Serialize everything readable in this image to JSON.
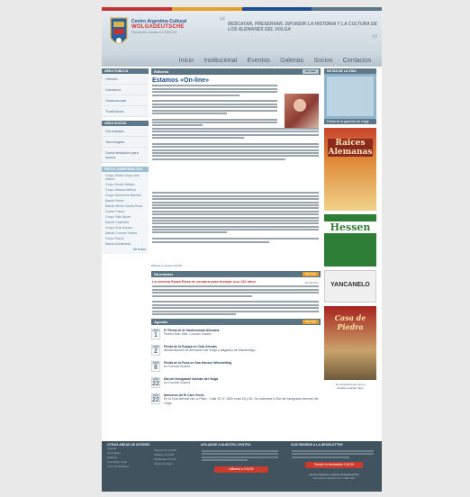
{
  "header": {
    "org_line1": "Centro Argentino Cultural",
    "org_line2": "WOLGADEUTSCHE",
    "org_line3": "Personería Jurídica IGJ 000 000",
    "quote": "RESCATAR, PRESERVAR, DIFUNDIR LA HISTORIA Y LA CULTURA DE LOS ALEMANES DEL VOLGA",
    "colors": {
      "accent": "#c33333",
      "brand": "#1d4f91",
      "sidebar": "#5e7889",
      "footer": "#41535f",
      "orange": "#e3a02b"
    }
  },
  "nav": {
    "items": [
      {
        "label": "Inicio"
      },
      {
        "label": "Institucional"
      },
      {
        "label": "Eventos"
      },
      {
        "label": "Galerias"
      },
      {
        "label": "Socios"
      },
      {
        "label": "Contactos"
      }
    ]
  },
  "left": {
    "box1": {
      "title": "AREA PUBLICA",
      "items": [
        {
          "label": "Historia"
        },
        {
          "label": "Literatura"
        },
        {
          "label": "Gastronomia"
        },
        {
          "label": "Tradiciones"
        }
      ]
    },
    "box2": {
      "title": "AREA SOCIOS",
      "items": [
        {
          "label": "Genealogía"
        },
        {
          "label": "Tecnologías"
        },
        {
          "label": "Documentación para socios"
        }
      ]
    },
    "fiesta": {
      "title": "FIESTA CAMPESINA 2011",
      "items": [
        {
          "label": "Grupo Sinsal Grupo Aus Ultdorf"
        },
        {
          "label": "Grupo Sinsal Villalba"
        },
        {
          "label": "Grupo Strauss Merino"
        },
        {
          "label": "Grupo Sarmiento Bismark"
        },
        {
          "label": "Banda Pardo"
        },
        {
          "label": "Banda Merino Santa Rosa"
        },
        {
          "label": "Cortez Pasca"
        },
        {
          "label": "Grupo Villa Sauze"
        },
        {
          "label": "Banda Calandria"
        },
        {
          "label": "Grupo Gran Aurora"
        },
        {
          "label": "Banda Coronel Suarez"
        },
        {
          "label": "Grupo Saenz"
        },
        {
          "label": "Banda Avellaneda"
        }
      ],
      "more": "Ver todos"
    }
  },
  "main": {
    "editorial": {
      "title": "Editorial",
      "button": "Ver mas",
      "headline": "Estamos «On-line»",
      "link": "Alleinas a nuestra CACW"
    },
    "novedades": {
      "title": "Novedades",
      "button": "Ver mas",
      "date": "09-08-2011",
      "headline": "La colonia Santa Rosa se prepara para festejar sus 110 años"
    },
    "agenda": {
      "title": "Agenda",
      "button": "Ver mas",
      "items": [
        {
          "month": "AGO",
          "day": "1",
          "title": "8° Fiesta de la Gastronomia Alemana",
          "sub": "Pueblo San José, Coronel Suarez"
        },
        {
          "month": "AGO",
          "day": "2",
          "title": "Fiesta de la Espiga en Club Alemán",
          "sub": "descendientes de alemanes del Volga y alagados de Macachalgo"
        },
        {
          "month": "AGO",
          "day": "8",
          "title": "Fiesta de la Poca en San Sousse Wimmelting",
          "sub": "en Coronel Suarez"
        },
        {
          "month": "AGO",
          "day": "22",
          "title": "Dia del Inmigrante Alemán del Volga",
          "sub": "en Coronel Suarez"
        },
        {
          "month": "AGO",
          "day": "22",
          "title": "Almuerzo de El Caro Verde",
          "sub": "En el Club Alemán de La Plata · Calle 22 N° 1060 entre 64 y 65. Se celebrará el Dia del Inmigrante Alemán del Volga"
        }
      ]
    }
  },
  "right": {
    "box1": {
      "title": "NOTAS DE LA VIDA"
    },
    "caption1": "Fiesta de la gauchos de volga",
    "ads": [
      {
        "name": "ad-raices-alemanas",
        "label": "Raices Alemanas",
        "color": "#c8442e"
      },
      {
        "name": "ad-hessen",
        "label": "Hessen",
        "color": "#2e7d37"
      },
      {
        "name": "ad-yancanelo",
        "label": "YANCANELO",
        "color": "#2b2b2b"
      },
      {
        "name": "ad-casa-de-piedra",
        "label": "Casa de Piedra",
        "color": "#a8231f"
      }
    ],
    "caption2": "Su publicidad aqui ahora",
    "caption3": "Detalles solicitar favor"
  },
  "footer": {
    "col1": {
      "title": "OTRAS AREAS DE INTERES",
      "items": [
        {
          "label": "Agenda"
        },
        {
          "label": "Novedades"
        },
        {
          "label": "Galerias"
        },
        {
          "label": "Formulario socio"
        },
        {
          "label": "Foro Social Bases"
        }
      ]
    },
    "col1b": {
      "items": [
        {
          "label": "Noticias de CACW"
        },
        {
          "label": "Afiliarte a CACW"
        },
        {
          "label": "Newsletter CACW"
        },
        {
          "label": "Antes del Volga"
        }
      ]
    },
    "col2": {
      "title": "AFILIARSE A NUESTRO CENTRO",
      "button": "Afiliarse a CACW"
    },
    "col3": {
      "title": "SUSCRIBIRSE A LA NEWSLETTER",
      "button": "Recibir la Newsletter CACW",
      "credit": "Centro Argentino Cultural Wolgadeutsche",
      "credit2": "Personería Jurídica IGJ 1 Blas 000"
    }
  }
}
